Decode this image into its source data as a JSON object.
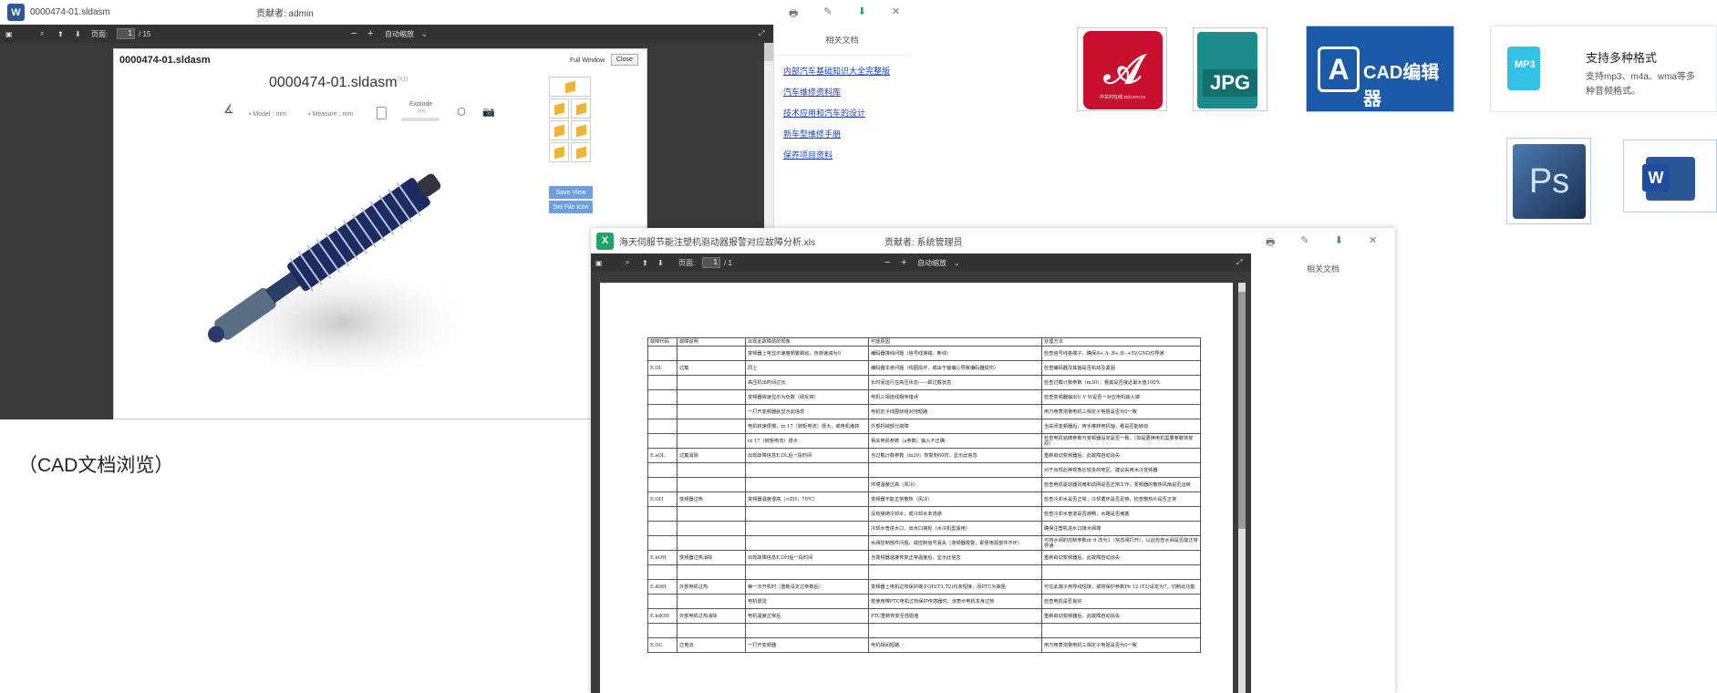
{
  "w1": {
    "badge": "W",
    "filename": "0000474-01.sldasm",
    "contributor": "贡献者: admin",
    "toolbar": {
      "page_label": "页面:",
      "page_value": "1",
      "page_total": "/ 15",
      "zoom": "自动缩放",
      "minus": "−",
      "plus": "+"
    },
    "cad": {
      "tab_title": "0000474-01.sldasm",
      "full_window": "Full Window",
      "close": "Close",
      "heading": "0000474-01.sldasm",
      "heading_sup": "(x1)",
      "model": "▪ Model : mm",
      "measure": "▪ Measure : mm",
      "explode": "Explode",
      "explode_val": "0%",
      "save_view": "Save View",
      "set_file_icon": "Set File Icon"
    },
    "sidebar": {
      "title": "相关文档",
      "links": [
        "内部汽车基础知识大全完整版",
        "汽车维修资料库",
        "技术应用和汽车的设计",
        "新车型维修手册",
        "保养项目资料"
      ]
    }
  },
  "caption": "（CAD文档浏览）",
  "w2": {
    "badge": "X",
    "filename": "海天伺服节能注塑机驱动器报警对应故障分析.xls",
    "contributor": "贡献者: 系统管理员",
    "toolbar": {
      "page_label": "页面:",
      "page_value": "1",
      "page_total": "/ 1",
      "zoom": "自动缩放",
      "minus": "−",
      "plus": "+"
    },
    "sidebar_title": "相关文档",
    "table": {
      "headers": [
        "故障代码",
        "故障说明",
        "出现此故障前的现象",
        "可能原因",
        "处理方法"
      ],
      "rows": [
        [
          "",
          "",
          "变频器上电显示速度频繁跳动，负转速减为0",
          "编码器接线问题（信号线接错、断线）",
          "检查信号线各端子，确保A+,A-,B+,B-,+5V,GND均导通"
        ],
        [
          "E.OL",
          "过载",
          "同上",
          "编码器本身问题（线圈损坏、或由于轴偏心导致编码器损伤）",
          "检查编码器及其轴是否松动及紧固"
        ],
        [
          "",
          "",
          "高压机出时间过长",
          "长时间运行在高压状态——即过载状态",
          "检查过载计数参数（m30），看其是否接近最大值100%"
        ],
        [
          "",
          "",
          "变频器转速显示为负数（即反转）",
          "电机三相连线相序错误",
          "检查变频器输出U V W是否一对应电机输入端"
        ],
        [
          "",
          "",
          "一打开变频器就显示此信息",
          "电机定子线圈绕组对地短路",
          "用万用表测量电机三相定子电阻是否为0一致"
        ],
        [
          "",
          "",
          "电机转速很慢，rz 17（转矩电流）很大，或电机堵转",
          "外部机械部分故障",
          "当关闭变频器后，用手推转电机轴，看是否能转动"
        ],
        [
          "",
          "",
          "rz 17（转矩电流）很大",
          "相关电机参数（a参数）输入不正确",
          "检查电机铭牌参数与变频器设定是否一致，（如是更换电机需要参数将复原）"
        ],
        [
          "E.aOL",
          "过载消除",
          "出现故障信息E.OL后一段时间",
          "当过载计数参数（m30）恢复到60时，显示此信息",
          "重新启动变频器后，此故障自动消失"
        ],
        [
          "",
          "",
          "",
          "",
          "对于出现此种现象比较多的地区，建议采用水冷变频器"
        ],
        [
          "",
          "",
          "",
          "环境温度过高（风冷）",
          "检查电机驱动器风扇和滤网是否正常工作，变频器的散热风扇是否运转"
        ],
        [
          "E.OH",
          "变频器过热",
          "变频器温度很高（>ZH，70℃）",
          "变频器不能正常散热（风冷）",
          "检查冷却水是否正常，冷却循环是否足够，检查散热片是否正常"
        ],
        [
          "",
          "",
          "",
          "没有接通冷却水，或冷却水未流通",
          "检查冷却水管道是否通畅，水路是否堵塞"
        ],
        [
          "",
          "",
          "",
          "冷却水管进水口、出水口接反（水冷机型适用）",
          "确保注塑机进水口接水阀端"
        ],
        [
          "",
          "",
          "",
          "水阀控制部件问题，或控制信号丢失（变频器报警，即便电源部件不坏）",
          "可将水阀的控制参数dr 6 改为1（常态阀打开），以此检查水阀是否能正常导通"
        ],
        [
          "E.nOH",
          "变频器过热消除",
          "出现故障信息E.OH后一段时间",
          "当变频器温度恢复正常温度后，显示此信息",
          "重新启动变频器后，此故障自动消失"
        ],
        [
          "",
          "",
          "",
          "",
          "",
          ""
        ],
        [
          "E.dOH",
          "外部电机过热",
          "第一次开机时（重新设定过参数后）",
          "变频器上电机过热保护端子OH(T1,T2)均未短接，而PTC为高阻",
          "可在此端子用导线短接，或将保护参数Pn 12 (T3)设定为7，切断此功能"
        ],
        [
          "",
          "",
          "电机很烫",
          "若使用带PTC电机过热保护传感器时，该表示电机本身过热",
          "检查电机是否良好"
        ],
        [
          "E.ndOH",
          "外部电机过热消除",
          "电机温度正常后",
          "PTC重新恢复至低阻值",
          "重新启动变频器后，此故障自动消失"
        ],
        [
          "",
          "",
          "",
          "",
          ""
        ],
        [
          "E.OC",
          "过电流",
          "一打开变频器",
          "电机相间短路",
          "用万用表测量电机三相定子电阻是否为0一致"
        ]
      ]
    }
  },
  "right_icons": {
    "pdf": {
      "name": "pdf-icon",
      "sub": "中关村在线 zol.com.cn"
    },
    "jpg": {
      "name": "jpg-icon",
      "label": "JPG"
    },
    "cad": {
      "name": "cad-editor-icon",
      "label": "CAD编辑器"
    },
    "mp3": {
      "name": "mp3-icon",
      "label": "MP3",
      "title": "支持多种格式",
      "desc": "支持mp3、m4a、wma等多种音频格式。"
    },
    "psd": {
      "name": "photoshop-icon",
      "label": "Ps"
    },
    "word": {
      "name": "word-icon",
      "label": "W"
    }
  },
  "colors": {
    "word_blue": "#2b5797",
    "excel_green": "#1fa463",
    "pdf_red": "#c8102e",
    "link": "#1a3fb5",
    "dark_toolbar": "#333333"
  }
}
